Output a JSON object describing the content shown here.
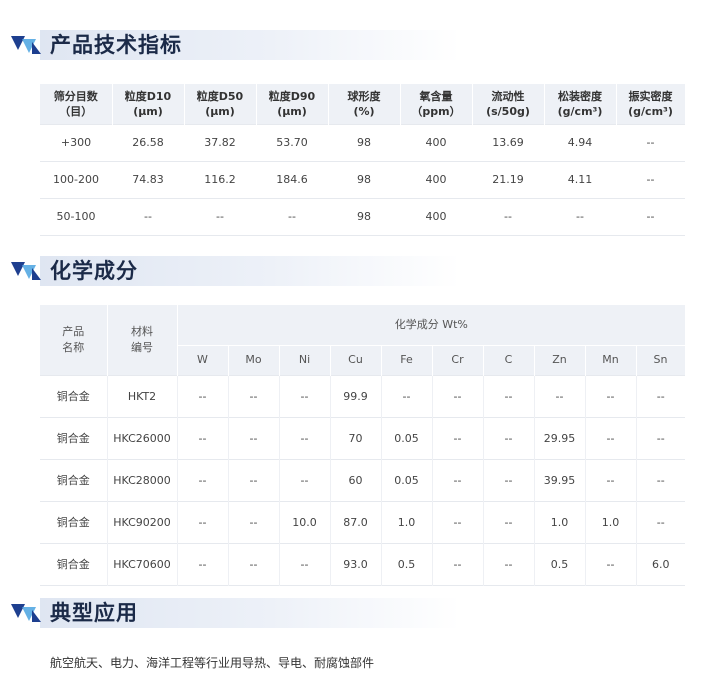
{
  "sections": {
    "spec_title": "产品技术指标",
    "chem_title": "化学成分",
    "app_title": "典型应用"
  },
  "spec_table": {
    "headers": [
      [
        "筛分目数",
        "（目）"
      ],
      [
        "粒度D10",
        "(μm)"
      ],
      [
        "粒度D50",
        "(μm)"
      ],
      [
        "粒度D90",
        "(μm)"
      ],
      [
        "球形度",
        "(%)"
      ],
      [
        "氧含量",
        "（ppm）"
      ],
      [
        "流动性",
        "(s/50g)"
      ],
      [
        "松装密度",
        "(g/cm³)"
      ],
      [
        "振实密度",
        "(g/cm³)"
      ]
    ],
    "rows": [
      [
        "+300",
        "26.58",
        "37.82",
        "53.70",
        "98",
        "400",
        "13.69",
        "4.94",
        "--"
      ],
      [
        "100-200",
        "74.83",
        "116.2",
        "184.6",
        "98",
        "400",
        "21.19",
        "4.11",
        "--"
      ],
      [
        "50-100",
        "--",
        "--",
        "--",
        "98",
        "400",
        "--",
        "--",
        "--"
      ]
    ]
  },
  "chem_table": {
    "product_header": [
      "产品",
      "名称"
    ],
    "material_header": [
      "材料",
      "编号"
    ],
    "group_header": "化学成分 Wt%",
    "elements": [
      "W",
      "Mo",
      "Ni",
      "Cu",
      "Fe",
      "Cr",
      "C",
      "Zn",
      "Mn",
      "Sn"
    ],
    "rows": [
      [
        "铜合金",
        "HKT2",
        "--",
        "--",
        "--",
        "99.9",
        "--",
        "--",
        "--",
        "--",
        "--",
        "--"
      ],
      [
        "铜合金",
        "HKC26000",
        "--",
        "--",
        "--",
        "70",
        "0.05",
        "--",
        "--",
        "29.95",
        "--",
        "--"
      ],
      [
        "铜合金",
        "HKC28000",
        "--",
        "--",
        "--",
        "60",
        "0.05",
        "--",
        "--",
        "39.95",
        "--",
        "--"
      ],
      [
        "铜合金",
        "HKC90200",
        "--",
        "--",
        "10.0",
        "87.0",
        "1.0",
        "--",
        "--",
        "1.0",
        "1.0",
        "--"
      ],
      [
        "铜合金",
        "HKC70600",
        "--",
        "--",
        "--",
        "93.0",
        "0.5",
        "--",
        "--",
        "0.5",
        "--",
        "6.0"
      ]
    ]
  },
  "application": "航空航天、电力、海洋工程等行业用导热、导电、耐腐蚀部件",
  "colors": {
    "title": "#1b2a48",
    "icon_dark": "#1e3f8f",
    "icon_light": "#4aa3e0",
    "header_bg": "#eef1f6"
  }
}
